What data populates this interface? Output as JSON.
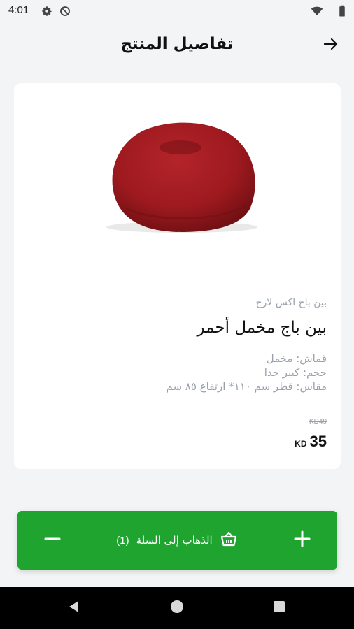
{
  "status_bar": {
    "time": "4:01",
    "icons": [
      "gear-icon",
      "data-saver-icon",
      "wifi-icon",
      "battery-icon"
    ]
  },
  "header": {
    "title": "تفاصيل المنتج",
    "back_icon": "arrow-right-icon"
  },
  "product": {
    "brand": "بين باج اكس لارج",
    "name": "بين باج مخمل أحمر",
    "specs": [
      "قماش: مخمل",
      "حجم: كبير جدا",
      "مقاس: قطر سم ١١٠* ارتفاع ٨٥ سم"
    ],
    "old_price": "KD49",
    "price": "35",
    "currency": "KD",
    "image_color": "#9e1a1f"
  },
  "cart_bar": {
    "label": "الذهاب إلى السلة",
    "count": "(1)",
    "minus_icon": "minus-icon",
    "plus_icon": "plus-icon",
    "basket_icon": "basket-icon",
    "color": "#1fa52f"
  },
  "nav_bar": {
    "icons": [
      "back-triangle-icon",
      "home-circle-icon",
      "recents-square-icon"
    ]
  }
}
